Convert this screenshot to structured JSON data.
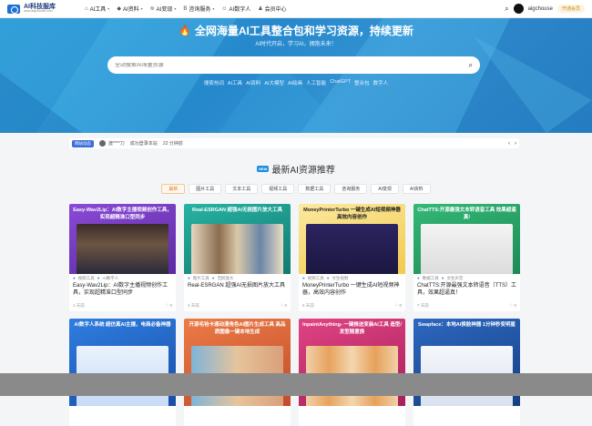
{
  "header": {
    "logo_title": "AI科技服库",
    "logo_sub": "www.aigchouse.com",
    "nav": [
      {
        "label": "AI工具",
        "icon": "home-icon"
      },
      {
        "label": "AI资料",
        "icon": "tag-icon"
      },
      {
        "label": "AI变现",
        "icon": "wifi-icon"
      },
      {
        "label": "咨询服务",
        "icon": "bold-icon"
      },
      {
        "label": "AI数字人",
        "icon": "person-icon"
      },
      {
        "label": "会员中心",
        "icon": "people-icon"
      }
    ],
    "username": "aigchouse",
    "vip_label": "开通会员"
  },
  "hero": {
    "title": "全网海量AI工具整合包和学习资源，持续更新",
    "subtitle": "AI时代开启，学习AI，拥抱未来！",
    "search_placeholder": "全站搜索AI海量资源",
    "hot_label": "搜索热词",
    "hot_words": [
      "AI工具",
      "AI资料",
      "AI大模型",
      "AI绘画",
      "人工智能",
      "ChatGPT",
      "整合包",
      "数字人"
    ]
  },
  "notice": {
    "badge": "网站动态",
    "user": "渡****刀",
    "action": "成功登录本站",
    "time": "22 分钟前"
  },
  "section": {
    "badge": "NEW",
    "title": "最新AI资源推荐",
    "filters": [
      "最新",
      "图片工具",
      "文本工具",
      "视频工具",
      "数据工具",
      "咨询服务",
      "AI变现",
      "AI资料"
    ]
  },
  "cards": [
    {
      "thumb_title": "Easy-Wav2Lip：AI数字主播视频创作工具，实现超精准口型同步",
      "cats": [
        "视频工具",
        "AI数字人"
      ],
      "title": "Easy-Wav2Lip：AI数字主播视频创作工具，实现超精准口型同步",
      "time": "1 天前",
      "likes": "0",
      "color": "#7b3fc4"
    },
    {
      "thumb_title": "Real-ESRGAN 超强AI无损图片放大工具",
      "cats": [
        "图片工具",
        "无损放大"
      ],
      "title": "Real-ESRGAN 超强AI无损图片放大工具",
      "time": "3 天前",
      "likes": "0",
      "color": "#1f9b8f"
    },
    {
      "thumb_title": "MoneyPrinterTurbo 一键生成AI短视频神器 高效内容创作",
      "cats": [
        "视频工具",
        "文生视频"
      ],
      "title": "MoneyPrinterTurbo 一键生成AI短视频神器，高效内容创作",
      "time": "6 天前",
      "likes": "0",
      "color": "#3d2d7a"
    },
    {
      "thumb_title": "ChatTTS:开源最强文本转语音工具 效果超逼真!",
      "cats": [
        "数据工具",
        "文生声音"
      ],
      "title": "ChatTTS:开源最强文本转语音（TTS）工具，效果超逼真！",
      "time": "7 天前",
      "likes": "0",
      "color": "#2b9f64"
    },
    {
      "thumb_title": "AI数字人系统 超仿真AI主播，电商必备神器",
      "cats": [],
      "title": "",
      "time": "",
      "likes": "",
      "color": "#2166c9"
    },
    {
      "thumb_title": "开源毛毡卡通动漫角色AI图片生成工具 高品质图像一键本地生成",
      "cats": [],
      "title": "",
      "time": "",
      "likes": "",
      "color": "#d8643a"
    },
    {
      "thumb_title": "InpaintAnything- 一键推送变装AI工具 造型/发型随意换",
      "cats": [],
      "title": "",
      "time": "",
      "likes": "",
      "color": "#c2306d"
    },
    {
      "thumb_title": "Swapface：本地AI换脸神器 1分钟秒变明星",
      "cats": [],
      "title": "",
      "time": "",
      "likes": "",
      "color": "#1d4f96"
    }
  ]
}
